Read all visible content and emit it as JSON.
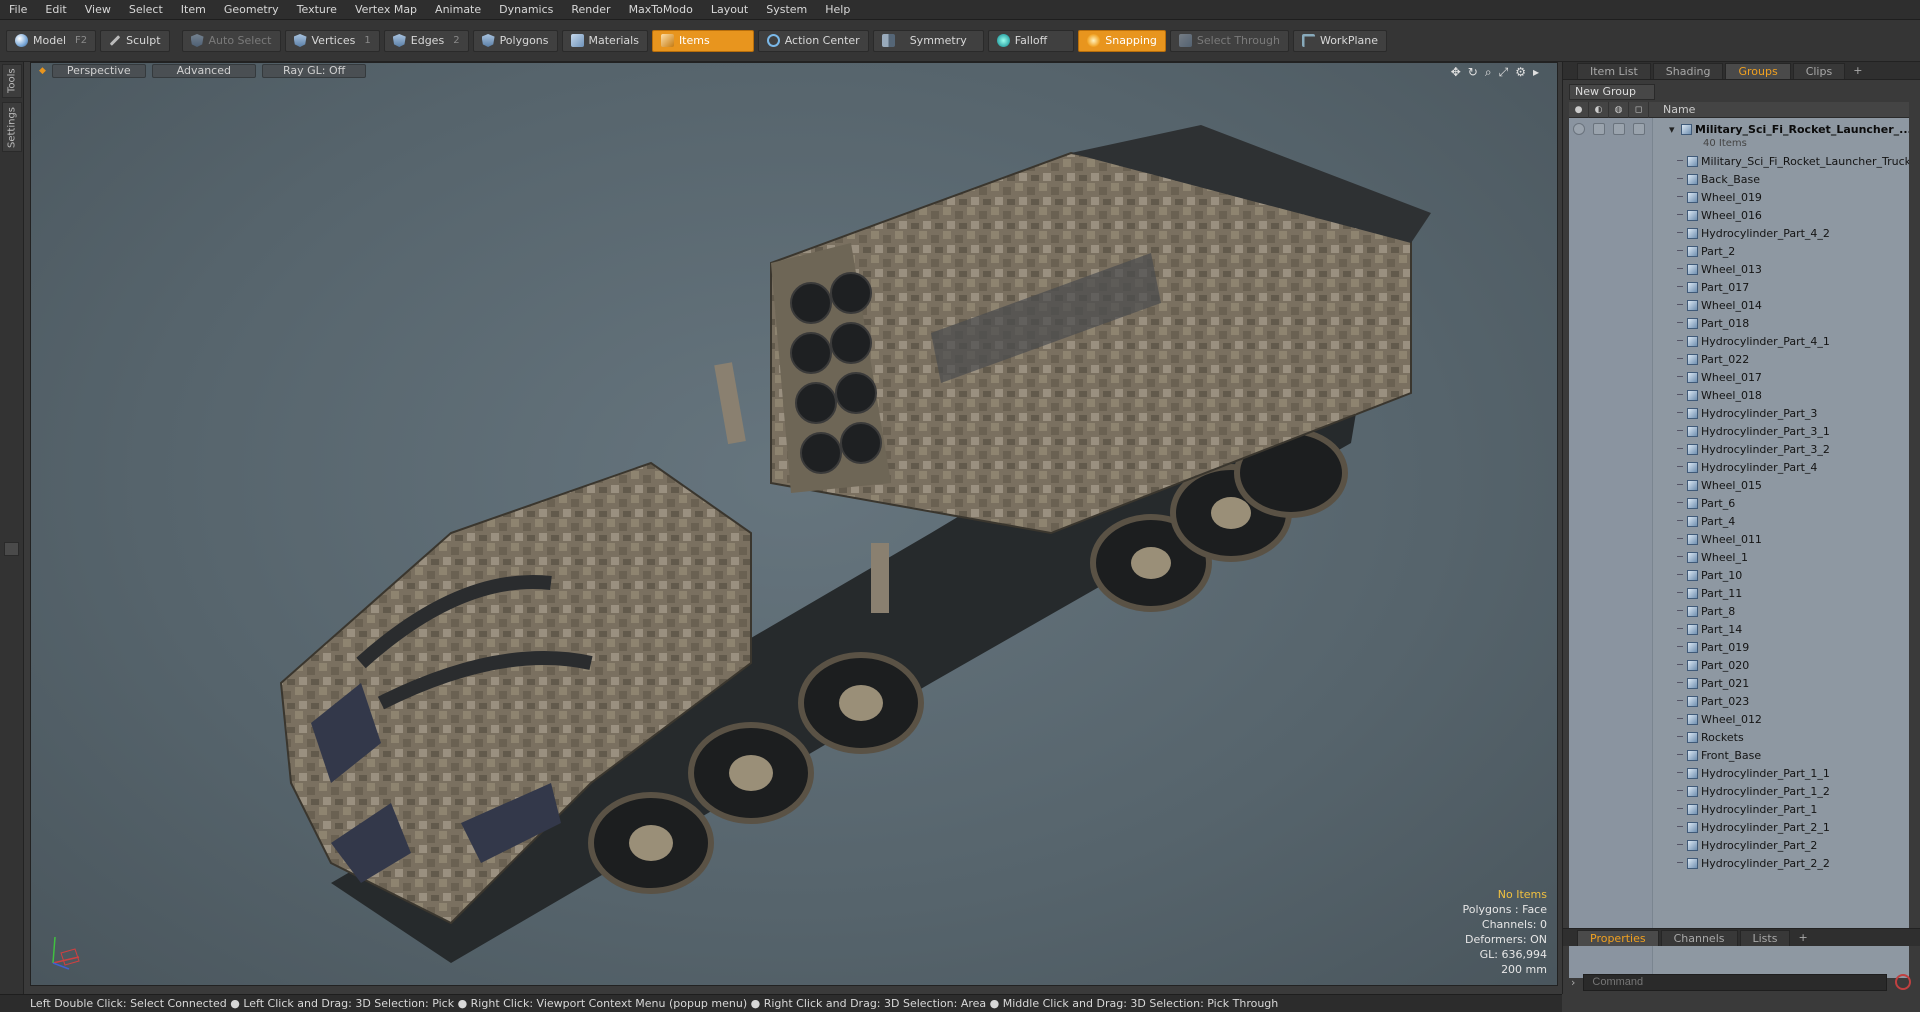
{
  "menu": [
    "File",
    "Edit",
    "View",
    "Select",
    "Item",
    "Geometry",
    "Texture",
    "Vertex Map",
    "Animate",
    "Dynamics",
    "Render",
    "MaxToModo",
    "Layout",
    "System",
    "Help"
  ],
  "toolbar": {
    "model": "Model",
    "model_key": "F2",
    "sculpt": "Sculpt",
    "auto_select": "Auto Select",
    "vertices": "Vertices",
    "vertices_key": "1",
    "edges": "Edges",
    "edges_key": "2",
    "polygons": "Polygons",
    "materials": "Materials",
    "items": "Items",
    "action_center": "Action Center",
    "symmetry": "Symmetry",
    "falloff": "Falloff",
    "snapping": "Snapping",
    "select_through": "Select Through",
    "workplane": "WorkPlane"
  },
  "left_tabs": [
    "Tools",
    "Settings"
  ],
  "viewport": {
    "perspective": "Perspective",
    "advanced": "Advanced",
    "raygl": "Ray GL: Off",
    "info": {
      "no_items": "No Items",
      "polygons": "Polygons : Face",
      "channels": "Channels: 0",
      "deformers": "Deformers: ON",
      "gl": "GL: 636,994",
      "scale": "200 mm"
    }
  },
  "panel_tabs": [
    "Item List",
    "Shading",
    "Groups",
    "Clips"
  ],
  "new_group": "New Group",
  "list_header_name": "Name",
  "group": {
    "name": "Military_Sci_Fi_Rocket_Launcher_...",
    "count": "40 Items"
  },
  "items": [
    "Military_Sci_Fi_Rocket_Launcher_Truck",
    "Back_Base",
    "Wheel_019",
    "Wheel_016",
    "Hydrocylinder_Part_4_2",
    "Part_2",
    "Wheel_013",
    "Part_017",
    "Wheel_014",
    "Part_018",
    "Hydrocylinder_Part_4_1",
    "Part_022",
    "Wheel_017",
    "Wheel_018",
    "Hydrocylinder_Part_3",
    "Hydrocylinder_Part_3_1",
    "Hydrocylinder_Part_3_2",
    "Hydrocylinder_Part_4",
    "Wheel_015",
    "Part_6",
    "Part_4",
    "Wheel_011",
    "Wheel_1",
    "Part_10",
    "Part_11",
    "Part_8",
    "Part_14",
    "Part_019",
    "Part_020",
    "Part_021",
    "Part_023",
    "Wheel_012",
    "Rockets",
    "Front_Base",
    "Hydrocylinder_Part_1_1",
    "Hydrocylinder_Part_1_2",
    "Hydrocylinder_Part_1",
    "Hydrocylinder_Part_2_1",
    "Hydrocylinder_Part_2",
    "Hydrocylinder_Part_2_2"
  ],
  "bottom_tabs": [
    "Properties",
    "Channels",
    "Lists"
  ],
  "command_placeholder": "Command",
  "status": "Left Double Click: Select Connected ● Left Click and Drag: 3D Selection: Pick ● Right Click: Viewport Context Menu (popup menu) ● Right Click and Drag: 3D Selection: Area ● Middle Click and Drag: 3D Selection: Pick Through",
  "colors": {
    "accent": "#e8951e",
    "viewport_bg": "#5e6c74",
    "list_bg": "#8e98a2"
  }
}
